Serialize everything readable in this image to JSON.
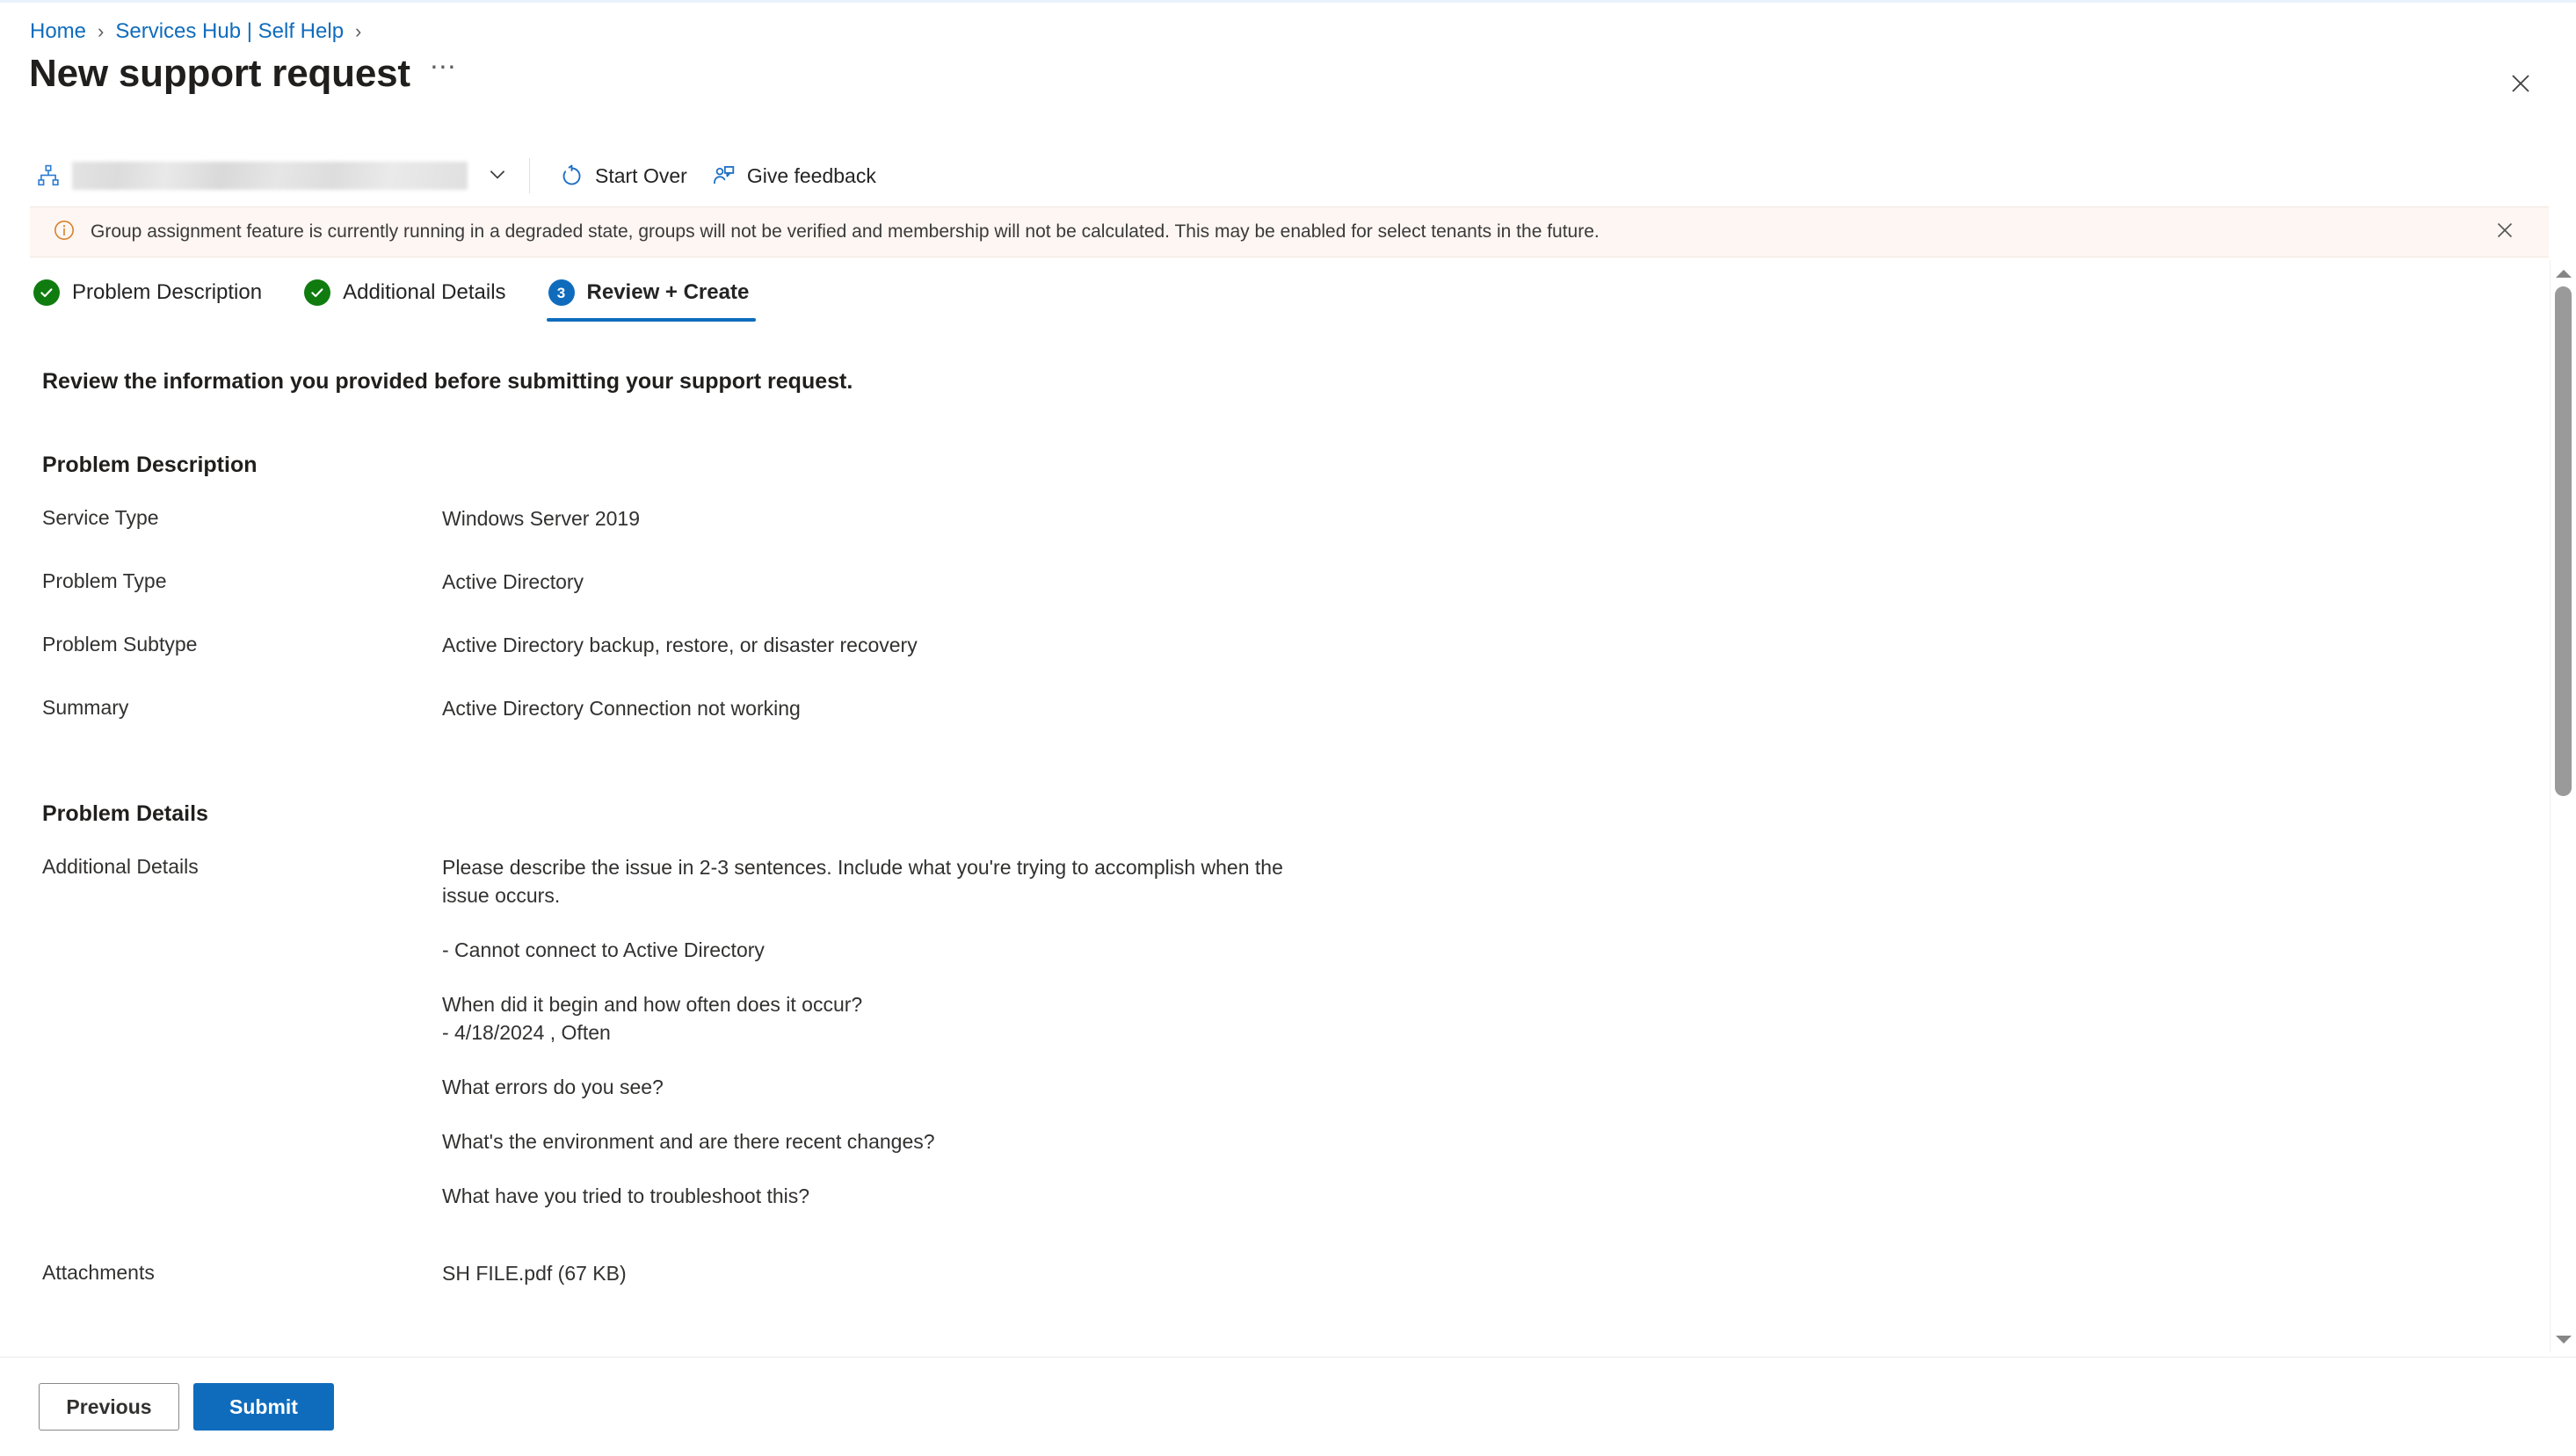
{
  "breadcrumb": {
    "items": [
      {
        "label": "Home"
      },
      {
        "label": "Services Hub | Self Help"
      }
    ],
    "separator": "›"
  },
  "header": {
    "title": "New support request",
    "ellipsis": "⋯",
    "close_icon": "close-icon"
  },
  "toolbar": {
    "org_icon": "org-hierarchy-icon",
    "org_value": "",
    "chevron_icon": "chevron-down-icon",
    "start_over": {
      "label": "Start Over",
      "icon": "refresh-icon"
    },
    "give_feedback": {
      "label": "Give feedback",
      "icon": "person-feedback-icon"
    }
  },
  "banner": {
    "icon": "info-circle-icon",
    "text": "Group assignment feature is currently running in a degraded state, groups will not be verified and membership will not be calculated. This may be enabled for select tenants in the future.",
    "close_icon": "close-icon",
    "accent_color": "#d8822c",
    "background_color": "#fdf6f3"
  },
  "steps": [
    {
      "label": "Problem Description",
      "state": "done",
      "badge": "✓"
    },
    {
      "label": "Additional Details",
      "state": "done",
      "badge": "✓"
    },
    {
      "label": "Review + Create",
      "state": "active",
      "badge": "3"
    }
  ],
  "main": {
    "lead": "Review the information you provided before submitting your support request.",
    "sections": [
      {
        "heading": "Problem Description",
        "fields": [
          {
            "label": "Service Type",
            "value": "Windows Server 2019"
          },
          {
            "label": "Problem Type",
            "value": "Active Directory"
          },
          {
            "label": "Problem Subtype",
            "value": "Active Directory backup, restore, or disaster recovery"
          },
          {
            "label": "Summary",
            "value": "Active Directory Connection not working"
          }
        ]
      },
      {
        "heading": "Problem Details",
        "fields": [
          {
            "label": "Additional Details",
            "paragraphs": [
              "Please describe the issue in 2-3 sentences. Include what you're trying to accomplish when the issue occurs.",
              "- Cannot connect to Active Directory",
              "When did it begin and how often does it occur?\n- 4/18/2024 , Often",
              "What errors do you see?",
              "What's the environment and are there recent changes?",
              "What have you tried to troubleshoot this?"
            ]
          },
          {
            "label": "Attachments",
            "value": "SH FILE.pdf (67 KB)"
          }
        ]
      }
    ]
  },
  "footer": {
    "previous_label": "Previous",
    "submit_label": "Submit"
  },
  "scrollbar": {
    "up_icon": "scroll-up-arrow-icon",
    "down_icon": "scroll-down-arrow-icon"
  },
  "colors": {
    "link": "#0f6cbd",
    "primary": "#0f6cbd",
    "success": "#107c10",
    "warning": "#d8822c"
  }
}
